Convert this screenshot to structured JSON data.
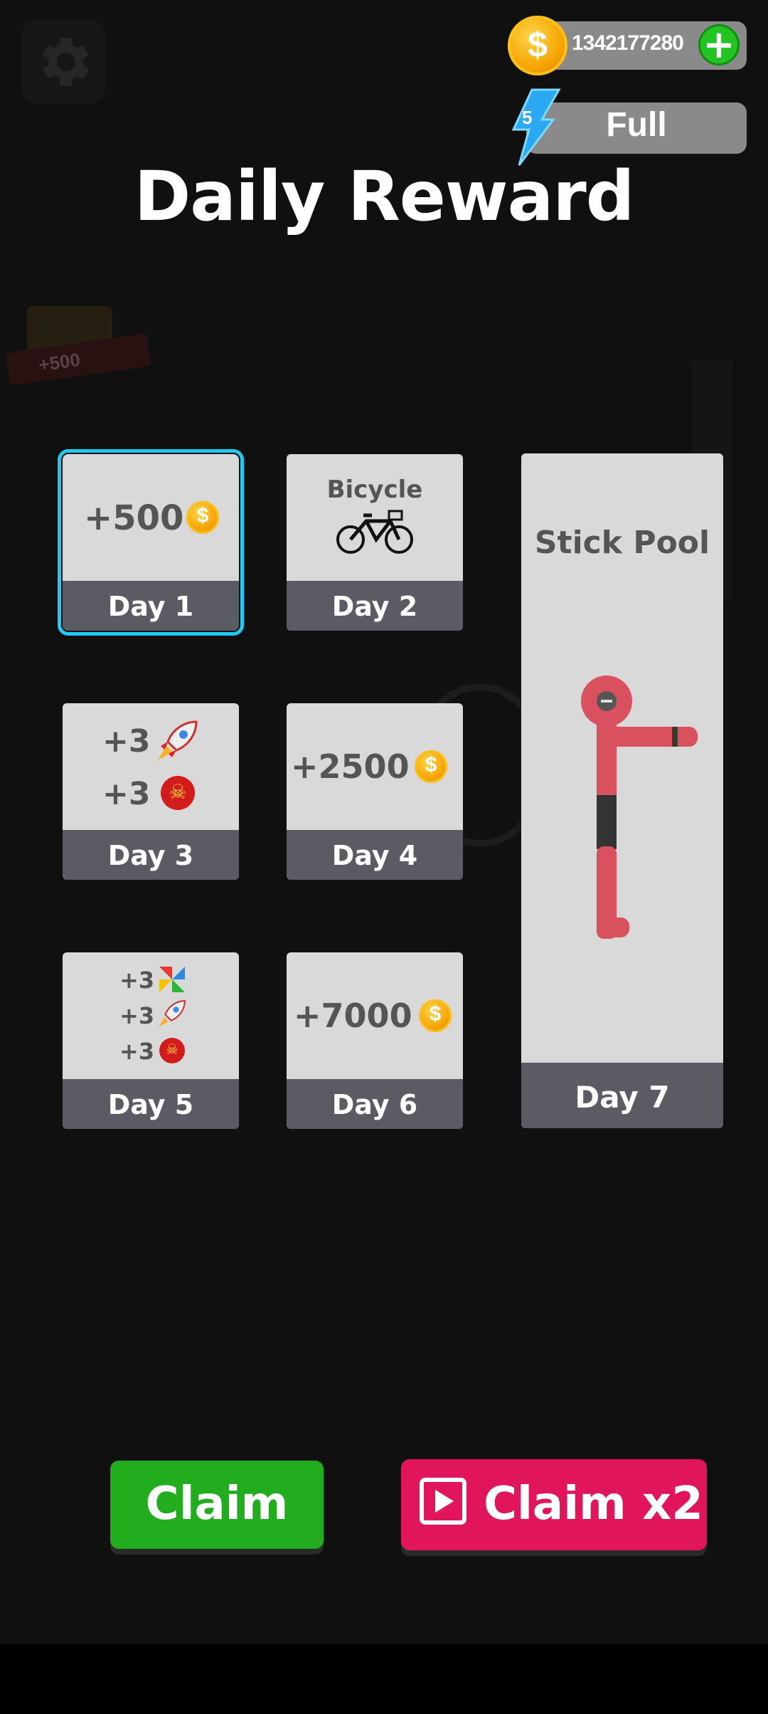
{
  "header": {
    "coins": "1342177280",
    "energy_count": "5",
    "energy_status": "Full",
    "title": "Daily Reward"
  },
  "background": {
    "banner_text": "+500"
  },
  "days": [
    {
      "label": "Day 1",
      "reward": "+500",
      "selected": true
    },
    {
      "label": "Day 2",
      "reward": "Bicycle"
    },
    {
      "label": "Day 3",
      "rewards": [
        "+3",
        "+3"
      ],
      "items": [
        "rocket",
        "bomb"
      ]
    },
    {
      "label": "Day 4",
      "reward": "+2500"
    },
    {
      "label": "Day 5",
      "rewards": [
        "+3",
        "+3",
        "+3"
      ],
      "items": [
        "pinwheel",
        "rocket",
        "bomb"
      ]
    },
    {
      "label": "Day 6",
      "reward": "+7000"
    },
    {
      "label": "Day 7",
      "reward": "Stick Pool"
    }
  ],
  "buttons": {
    "claim": "Claim",
    "claim_x2": "Claim x2"
  },
  "colors": {
    "selected_outline": "#1fc9f0",
    "claim": "#22ad1f",
    "claim_x2": "#e0155c",
    "coin": "#f5a300"
  }
}
